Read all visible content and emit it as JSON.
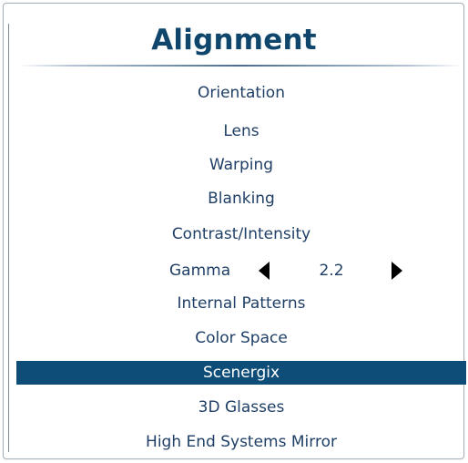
{
  "title": "Alignment",
  "menu": {
    "items": [
      {
        "label": "Orientation"
      },
      {
        "label": "Lens"
      },
      {
        "label": "Warping"
      },
      {
        "label": "Blanking"
      },
      {
        "label": "Contrast/Intensity"
      },
      {
        "label": "Internal Patterns"
      },
      {
        "label": "Color Space"
      },
      {
        "label": "Scenergix",
        "selected": true
      },
      {
        "label": "3D Glasses"
      },
      {
        "label": "High End Systems Mirror"
      }
    ],
    "gamma": {
      "label": "Gamma",
      "value": "2.2",
      "decrease_icon": "triangle-left",
      "increase_icon": "triangle-right"
    }
  },
  "colors": {
    "title": "#10466b",
    "item_text": "#1f3f66",
    "selected_background": "#0e4d78",
    "selected_text": "#ffffff"
  }
}
